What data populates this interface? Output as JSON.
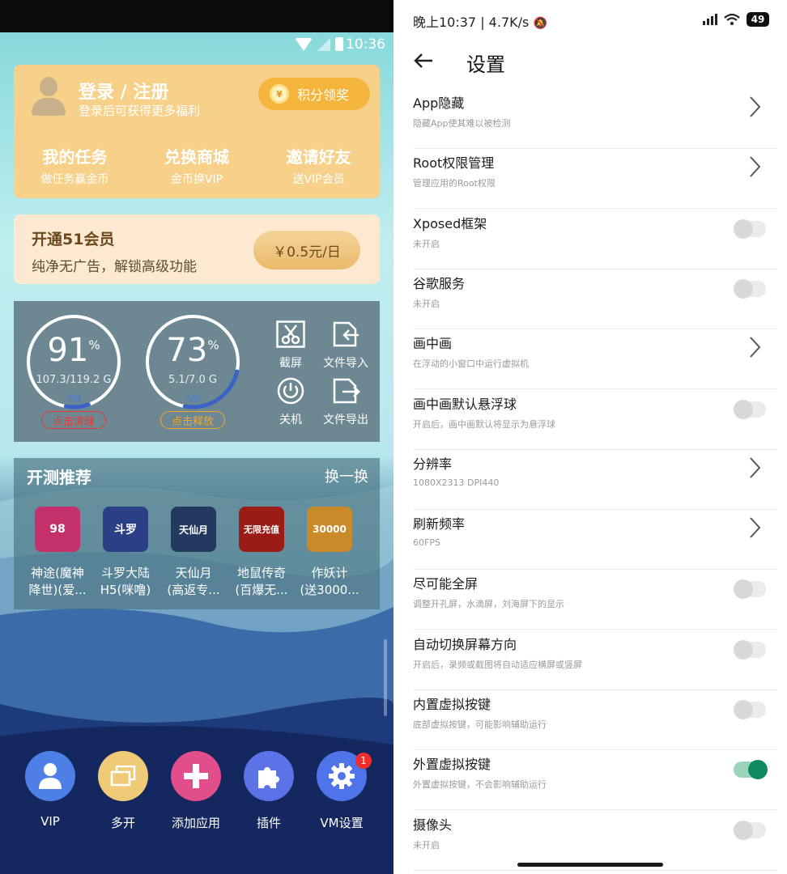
{
  "left_phone": {
    "status": {
      "time": "10:36"
    },
    "login": {
      "title": "登录 / 注册",
      "subtitle": "登录后可获得更多福利",
      "claim_label": "积分领奖",
      "links": [
        {
          "title": "我的任务",
          "sub": "做任务赢金币"
        },
        {
          "title": "兑换商城",
          "sub": "金币换VIP"
        },
        {
          "title": "邀请好友",
          "sub": "送VIP会员"
        }
      ]
    },
    "vip_banner": {
      "title": "开通51会员",
      "subtitle": "纯净无广告，解锁高级功能",
      "price": "￥0.5元/日"
    },
    "gauges": [
      {
        "percent": "91",
        "percent_value": 91,
        "unit": "%",
        "detail": "107.3/119.2 G",
        "kind": "存储",
        "action": "点击清理",
        "color": "#e53935"
      },
      {
        "percent": "73",
        "percent_value": 73,
        "unit": "%",
        "detail": "5.1/7.0 G",
        "kind": "内存",
        "action": "点击释放",
        "color": "#f5a623"
      }
    ],
    "tools": [
      {
        "label": "截屏",
        "icon": "scissors-icon"
      },
      {
        "label": "文件导入",
        "icon": "file-import-icon"
      },
      {
        "label": "关机",
        "icon": "power-icon"
      },
      {
        "label": "文件导出",
        "icon": "file-export-icon"
      }
    ],
    "recommend": {
      "title": "开测推荐",
      "refresh": "换一换",
      "games": [
        {
          "name": "神途(魔神\n降世)(爱...",
          "tile_text": "98",
          "color": "#c3306a"
        },
        {
          "name": "斗罗大陆\nH5(咪噜)",
          "tile_text": "斗罗",
          "color": "#2a3f86"
        },
        {
          "name": "天仙月\n(高返专...",
          "tile_text": "天仙月",
          "color": "#233a5e"
        },
        {
          "name": "地鼠传奇\n(百爆无...",
          "tile_text": "无限充值",
          "color": "#9b1c16"
        },
        {
          "name": "作妖计\n(送3000...",
          "tile_text": "30000",
          "color": "#c98a2a"
        }
      ]
    },
    "bottom_nav": [
      {
        "label": "VIP",
        "icon": "person-icon",
        "color": "#4e7fe6"
      },
      {
        "label": "多开",
        "icon": "multi-window-icon",
        "color": "#efcb77"
      },
      {
        "label": "添加应用",
        "icon": "plus-icon",
        "color": "#e24d8b"
      },
      {
        "label": "插件",
        "icon": "puzzle-icon",
        "color": "#5b73e6"
      },
      {
        "label": "VM设置",
        "icon": "gear-icon",
        "color": "#4f73e8",
        "badge": "1"
      }
    ]
  },
  "right_phone": {
    "status": {
      "left": "晚上10:37 | 4.7K/s",
      "battery": "49"
    },
    "header": {
      "title": "设置"
    },
    "settings": [
      {
        "title": "App隐藏",
        "desc": "隐藏App使其难以被检测",
        "control": "chevron"
      },
      {
        "title": "Root权限管理",
        "desc": "管理应用的Root权限",
        "control": "chevron"
      },
      {
        "title": "Xposed框架",
        "desc": "未开启",
        "control": "toggle",
        "on": false
      },
      {
        "title": "谷歌服务",
        "desc": "未开启",
        "control": "toggle",
        "on": false
      },
      {
        "title": "画中画",
        "desc": "在浮动的小窗口中运行虚拟机",
        "control": "chevron"
      },
      {
        "title": "画中画默认悬浮球",
        "desc": "开启后，画中画默认将显示为悬浮球",
        "control": "toggle",
        "on": false
      },
      {
        "title": "分辨率",
        "desc": "1080X2313 DPI440",
        "control": "chevron"
      },
      {
        "title": "刷新频率",
        "desc": "60FPS",
        "control": "chevron"
      },
      {
        "title": "尽可能全屏",
        "desc": "调整开孔屏，水滴屏，刘海屏下的显示",
        "control": "toggle",
        "on": false
      },
      {
        "title": "自动切换屏幕方向",
        "desc": "开启后，录频或截图将自动适应横屏或竖屏",
        "control": "toggle",
        "on": false
      },
      {
        "title": "内置虚拟按键",
        "desc": "底部虚拟按键，可能影响辅助运行",
        "control": "toggle",
        "on": false
      },
      {
        "title": "外置虚拟按键",
        "desc": "外置虚拟按键，不会影响辅助运行",
        "control": "toggle",
        "on": true
      },
      {
        "title": "摄像头",
        "desc": "未开启",
        "control": "toggle",
        "on": false
      }
    ]
  }
}
